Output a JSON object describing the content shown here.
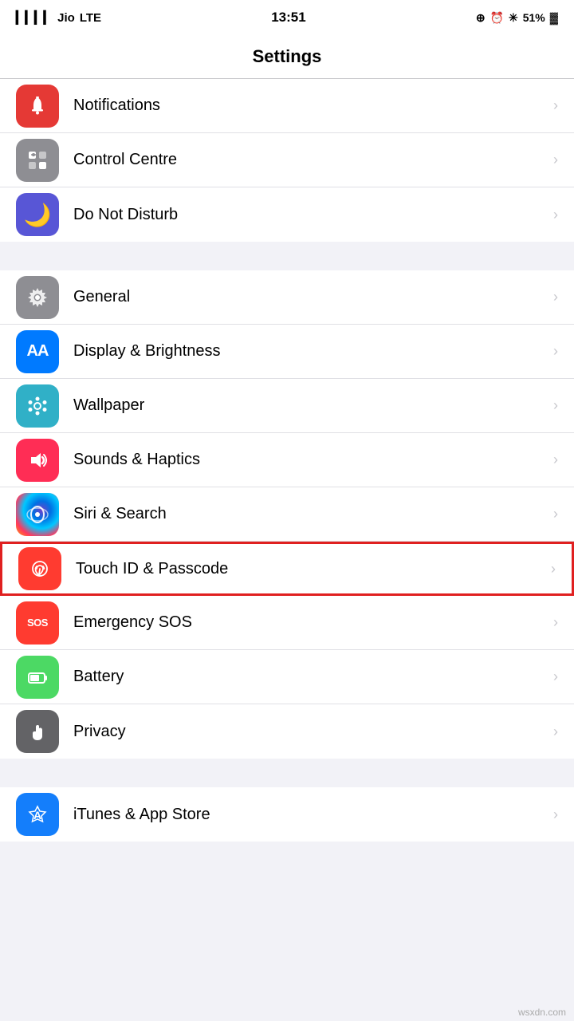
{
  "statusBar": {
    "carrier": "Jio",
    "network": "LTE",
    "time": "13:51",
    "batteryPercent": "51%"
  },
  "header": {
    "title": "Settings"
  },
  "sections": [
    {
      "id": "notifications-section",
      "items": [
        {
          "id": "notifications",
          "label": "Notifications",
          "iconType": "icon-red",
          "iconSymbol": "🔔",
          "highlighted": false
        },
        {
          "id": "control-centre",
          "label": "Control Centre",
          "iconType": "icon-gray",
          "iconSymbol": "⚙",
          "highlighted": false
        },
        {
          "id": "do-not-disturb",
          "label": "Do Not Disturb",
          "iconType": "icon-purple",
          "iconSymbol": "🌙",
          "highlighted": false
        }
      ]
    },
    {
      "id": "general-section",
      "items": [
        {
          "id": "general",
          "label": "General",
          "iconType": "icon-gear",
          "iconSymbol": "⚙",
          "highlighted": false
        },
        {
          "id": "display-brightness",
          "label": "Display & Brightness",
          "iconType": "icon-blue",
          "iconSymbol": "AA",
          "highlighted": false
        },
        {
          "id": "wallpaper",
          "label": "Wallpaper",
          "iconType": "icon-teal",
          "iconSymbol": "✿",
          "highlighted": false
        },
        {
          "id": "sounds-haptics",
          "label": "Sounds & Haptics",
          "iconType": "icon-pink",
          "iconSymbol": "🔊",
          "highlighted": false
        },
        {
          "id": "siri-search",
          "label": "Siri & Search",
          "iconType": "siri-icon",
          "iconSymbol": "◎",
          "highlighted": false
        },
        {
          "id": "touch-id-passcode",
          "label": "Touch ID & Passcode",
          "iconType": "icon-touchid",
          "iconSymbol": "◉",
          "highlighted": true
        },
        {
          "id": "emergency-sos",
          "label": "Emergency SOS",
          "iconType": "icon-sos",
          "iconSymbol": "SOS",
          "highlighted": false
        },
        {
          "id": "battery",
          "label": "Battery",
          "iconType": "icon-battery",
          "iconSymbol": "🔋",
          "highlighted": false
        },
        {
          "id": "privacy",
          "label": "Privacy",
          "iconType": "icon-privacy",
          "iconSymbol": "✋",
          "highlighted": false
        }
      ]
    },
    {
      "id": "store-section",
      "items": [
        {
          "id": "itunes-app-store",
          "label": "iTunes & App Store",
          "iconType": "icon-appstore",
          "iconSymbol": "A",
          "highlighted": false
        }
      ]
    }
  ],
  "watermark": "wsxdn.com"
}
